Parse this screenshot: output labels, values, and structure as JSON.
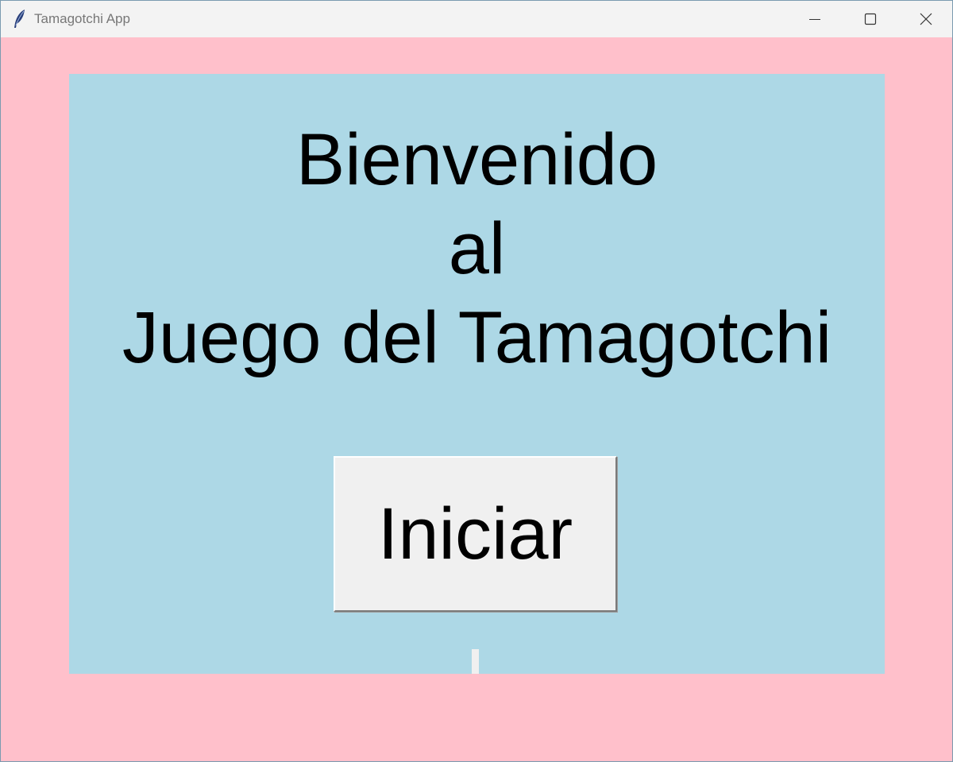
{
  "window": {
    "title": "Tamagotchi App",
    "icon": "feather-icon",
    "controls": {
      "minimize": "minimize-icon",
      "maximize": "maximize-icon",
      "close": "close-icon"
    }
  },
  "main": {
    "welcome_lines": [
      "Bienvenido",
      "al",
      "Juego del Tamagotchi"
    ],
    "start_button_label": "Iniciar"
  },
  "colors": {
    "window_background": "#ffc0cb",
    "panel_background": "#add8e6",
    "button_background": "#f0f0f0",
    "titlebar_background": "#f3f3f3"
  }
}
